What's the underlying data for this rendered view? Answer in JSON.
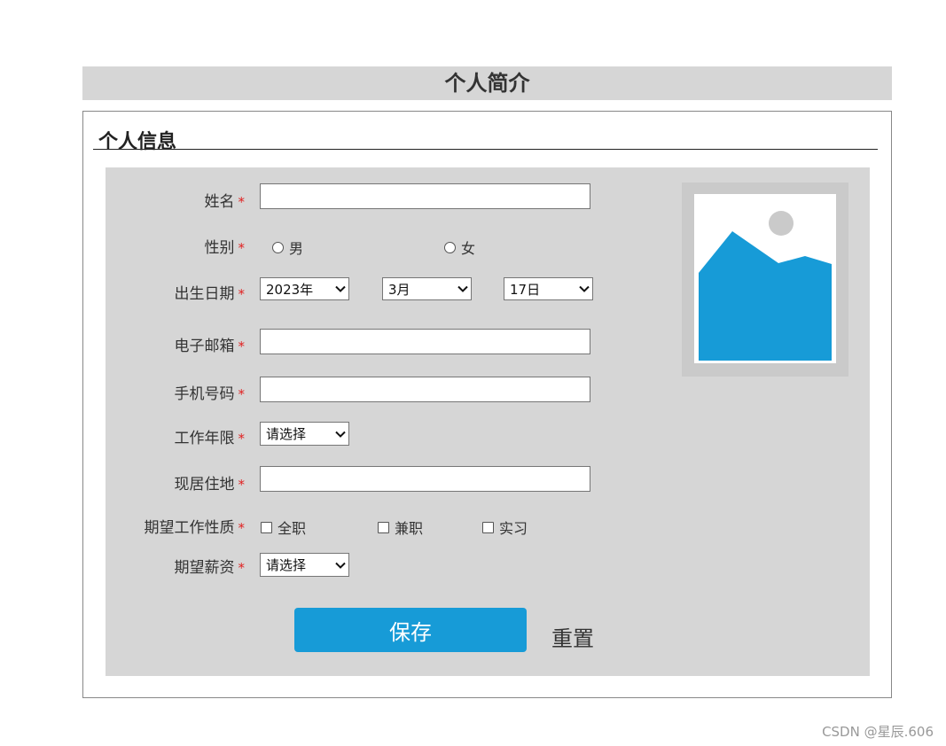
{
  "page": {
    "title": "个人简介"
  },
  "section": {
    "title": "个人信息"
  },
  "required_mark": "*",
  "fields": {
    "name": {
      "label": "姓名",
      "value": "",
      "placeholder": ""
    },
    "gender": {
      "label": "性别",
      "options": [
        "男",
        "女"
      ],
      "selected": null
    },
    "birthday": {
      "label": "出生日期",
      "year": "2023年",
      "month": "3月",
      "day": "17日"
    },
    "email": {
      "label": "电子邮箱",
      "value": "",
      "placeholder": ""
    },
    "phone": {
      "label": "手机号码",
      "value": "",
      "placeholder": ""
    },
    "work_years": {
      "label": "工作年限",
      "selected": "请选择"
    },
    "residence": {
      "label": "现居住地",
      "value": "",
      "placeholder": ""
    },
    "job_type": {
      "label": "期望工作性质",
      "options": [
        "全职",
        "兼职",
        "实习"
      ],
      "checked": [
        false,
        false,
        false
      ]
    },
    "salary": {
      "label": "期望薪资",
      "selected": "请选择"
    }
  },
  "buttons": {
    "save_label": "保存",
    "reset_label": "重置"
  },
  "photo": {
    "icon": "image-placeholder-icon"
  },
  "watermark": "CSDN @星辰.606",
  "colors": {
    "accent": "#179bd7",
    "panel": "#d6d6d6",
    "required": "#e02020",
    "photo_frame": "#cacaca"
  }
}
